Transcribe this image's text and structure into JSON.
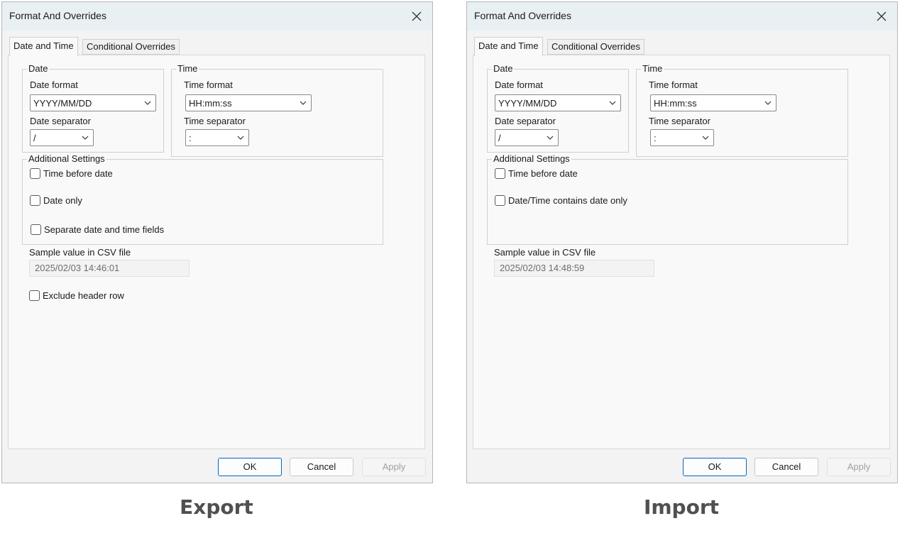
{
  "dialogs": [
    {
      "title": "Format And Overrides",
      "tabs": [
        "Date and Time",
        "Conditional Overrides"
      ],
      "date_group": {
        "legend": "Date",
        "format_label": "Date format",
        "format_value": "YYYY/MM/DD",
        "separator_label": "Date separator",
        "separator_value": "/"
      },
      "time_group": {
        "legend": "Time",
        "format_label": "Time format",
        "format_value": "HH:mm:ss",
        "separator_label": "Time separator",
        "separator_value": ":"
      },
      "additional": {
        "legend": "Additional Settings",
        "checkboxes": [
          "Time before date",
          "Date only",
          "Separate date and time fields"
        ]
      },
      "sample_label": "Sample value in CSV file",
      "sample_value": "2025/02/03 14:46:01",
      "exclude_header": "Exclude header row",
      "buttons": {
        "ok": "OK",
        "cancel": "Cancel",
        "apply": "Apply"
      }
    },
    {
      "title": "Format And Overrides",
      "tabs": [
        "Date and Time",
        "Conditional Overrides"
      ],
      "date_group": {
        "legend": "Date",
        "format_label": "Date format",
        "format_value": "YYYY/MM/DD",
        "separator_label": "Date separator",
        "separator_value": "/"
      },
      "time_group": {
        "legend": "Time",
        "format_label": "Time format",
        "format_value": "HH:mm:ss",
        "separator_label": "Time separator",
        "separator_value": ":"
      },
      "additional": {
        "legend": "Additional Settings",
        "checkboxes": [
          "Time before date",
          "Date/Time contains date only"
        ]
      },
      "sample_label": "Sample value in CSV file",
      "sample_value": "2025/02/03 14:48:59",
      "buttons": {
        "ok": "OK",
        "cancel": "Cancel",
        "apply": "Apply"
      }
    }
  ],
  "captions": {
    "left": "Export",
    "right": "Import"
  }
}
